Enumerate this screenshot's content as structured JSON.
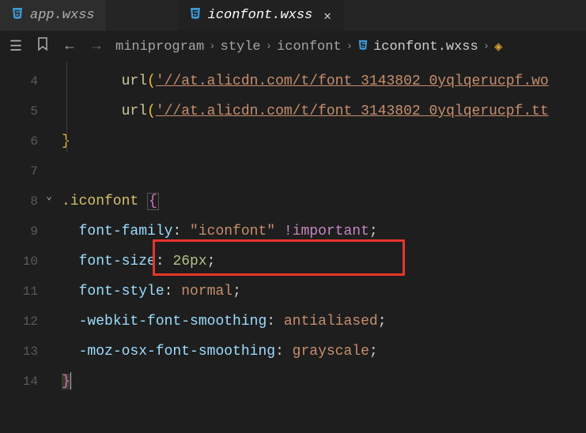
{
  "tabs": [
    {
      "icon": "⧉",
      "label": "app.wxss"
    },
    {
      "icon": "⧉",
      "label": "iconfont.wxss"
    }
  ],
  "toolbar": {
    "list_icon": "☰",
    "bookmark_icon": "🔖",
    "back_icon": "←",
    "forward_icon": "→"
  },
  "breadcrumb": {
    "items": [
      "miniprogram",
      "style",
      "iconfont"
    ],
    "file": "iconfont.wxss",
    "chev": "›"
  },
  "code": {
    "lines": [
      {
        "n": "4"
      },
      {
        "n": "5"
      },
      {
        "n": "6"
      },
      {
        "n": "7"
      },
      {
        "n": "8"
      },
      {
        "n": "9"
      },
      {
        "n": "10"
      },
      {
        "n": "11"
      },
      {
        "n": "12"
      },
      {
        "n": "13"
      },
      {
        "n": "14"
      }
    ],
    "l4": {
      "func": "url",
      "lp": "(",
      "str": "'//at.alicdn.com/t/font_3143802_0yqlqerucpf.wo"
    },
    "l5": {
      "func": "url",
      "lp": "(",
      "str": "'//at.alicdn.com/t/font_3143802_0yqlqerucpf.tt"
    },
    "l6": {
      "brace": "}"
    },
    "l8": {
      "sel": ".iconfont",
      "brace": "{"
    },
    "l9": {
      "prop": "font-family",
      "colon": ":",
      "val": " \"iconfont\" ",
      "imp": "!important",
      "semi": ";"
    },
    "l10": {
      "prop": "font-size",
      "colon": ":",
      "num": " 26",
      "unit": "px",
      "semi": ";"
    },
    "l11": {
      "prop": "font-style",
      "colon": ":",
      "val": " normal",
      "semi": ";"
    },
    "l12": {
      "prop": "-webkit-font-smoothing",
      "colon": ":",
      "val": " antialiased",
      "semi": ";"
    },
    "l13": {
      "prop": "-moz-osx-font-smoothing",
      "colon": ":",
      "val": " grayscale",
      "semi": ";"
    },
    "l14": {
      "brace": "}"
    }
  },
  "fold": "⌄"
}
